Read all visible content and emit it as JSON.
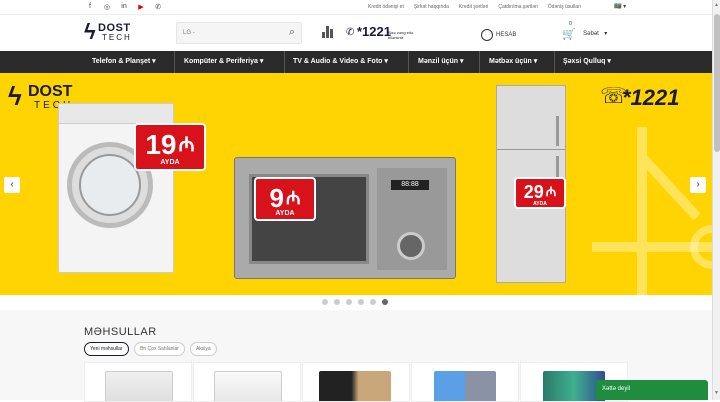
{
  "topbar": {
    "social": [
      {
        "icon": "facebook-icon",
        "glyph": "f"
      },
      {
        "icon": "instagram-icon",
        "glyph": "◎"
      },
      {
        "icon": "linkedin-icon",
        "glyph": "in"
      },
      {
        "icon": "youtube-icon",
        "glyph": "▶"
      },
      {
        "icon": "whatsapp-icon",
        "glyph": "✆"
      }
    ],
    "links": [
      "Kredit ödənişi et",
      "Şirkət haqqında",
      "Kredit şərtləri",
      "Çatdırılma şərtləri",
      "Ödəniş üsulları"
    ],
    "language_flag": "🇦🇿"
  },
  "header": {
    "logo_top": "DOST",
    "logo_bottom": "TECH",
    "search_placeholder": "LG -",
    "phone_number": "*1221",
    "phone_sub": "Bizə zəng edə bilərsiniz",
    "account_label": "HESAB",
    "cart_count": "0",
    "cart_label": "Səbət"
  },
  "nav": [
    {
      "label": "Telefon & Planşet"
    },
    {
      "label": "Kompüter & Periferiya"
    },
    {
      "label": "TV & Audio & Video & Foto"
    },
    {
      "label": "Mənzil üçün"
    },
    {
      "label": "Mətbəx üçün"
    },
    {
      "label": "Şəxsi Qulluq"
    }
  ],
  "hero": {
    "logo_top": "DOST",
    "logo_bottom": "TECH",
    "phone": "*1221",
    "tags": [
      {
        "number": "19",
        "unit": "AYDA"
      },
      {
        "number": "9",
        "unit": "AYDA"
      },
      {
        "number": "29",
        "unit": "AYDA"
      }
    ],
    "microwave_display": "88:88",
    "slide_count": 6,
    "active_slide": 6,
    "background_color": "#ffd400",
    "tag_color": "#d8121a"
  },
  "products": {
    "title": "MƏHSULLAR",
    "tabs": [
      "Yeni məhsullar",
      "Ən Çox Satılanlar",
      "Aksiya"
    ],
    "active_tab": 0,
    "cards": [
      {
        "name": "dishwasher"
      },
      {
        "name": "dishwasher"
      },
      {
        "name": "smartphone"
      },
      {
        "name": "smartphone"
      },
      {
        "name": "smartphone"
      }
    ]
  },
  "chat": {
    "label": "Xəttə deyil"
  }
}
